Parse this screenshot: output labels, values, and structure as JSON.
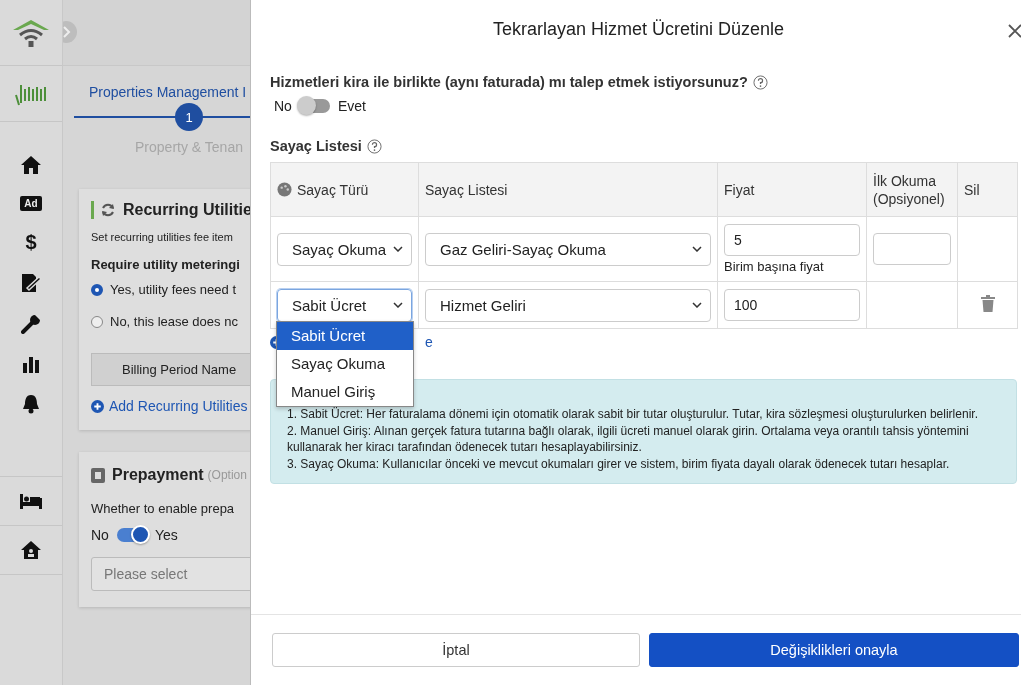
{
  "sidebar": {
    "items": [
      {
        "kind": "home"
      },
      {
        "kind": "badge",
        "label": "Ad"
      },
      {
        "kind": "glyph",
        "label": "$"
      },
      {
        "kind": "sign"
      },
      {
        "kind": "wrench"
      },
      {
        "kind": "chart"
      },
      {
        "kind": "bell"
      }
    ],
    "bottom_items": [
      {
        "kind": "bed"
      },
      {
        "kind": "house"
      }
    ]
  },
  "background_page": {
    "breadcrumb": "Properties Management I",
    "steps": [
      {
        "number": "1",
        "label": "Property & Tenan",
        "selected": true
      }
    ],
    "utilities_card": {
      "title": "Recurring Utilitie",
      "description": "Set recurring utilities fee item",
      "question": "Require utility meteringi",
      "options": [
        {
          "label": "Yes, utility fees need t",
          "selected": true
        },
        {
          "label": "No, this lease does nc",
          "selected": false
        }
      ],
      "column_header": "Billing Period Name",
      "add_link": "Add Recurring Utilities"
    },
    "prepayment_card": {
      "title": "Prepayment",
      "hint": "(Option",
      "question": "Whether to enable prepa",
      "toggle": {
        "off_label": "No",
        "on_label": "Yes",
        "on": true
      },
      "select": {
        "placeholder": "Please select"
      }
    }
  },
  "modal": {
    "title": "Tekrarlayan Hizmet Ücretini Düzenle",
    "question": "Hizmetleri kira ile birlikte (aynı faturada) mı talep etmek istiyorsunuz?",
    "toggle": {
      "off_label": "No",
      "on_label": "Evet",
      "on": false
    },
    "list_title": "Sayaç Listesi",
    "table": {
      "columns": [
        "Sayaç Türü",
        "Sayaç Listesi",
        "Fiyat",
        "İlk Okuma (Opsiyonel)",
        "Sil"
      ],
      "rows": [
        {
          "type": "Sayaç Okuma",
          "list": "Gaz Geliri-Sayaç Okuma",
          "price": "5",
          "price_hint": "Birim başına fiyat",
          "has_reading_field": true,
          "deletable": false,
          "focused": false
        },
        {
          "type": "Sabit Ücret",
          "list": "Hizmet Geliri",
          "price": "100",
          "has_reading_field": false,
          "deletable": true,
          "focused": true
        }
      ]
    },
    "dropdown": {
      "options": [
        {
          "label": "Sabit Ücret",
          "selected": true
        },
        {
          "label": "Sayaç Okuma",
          "selected": false
        },
        {
          "label": "Manuel Giriş",
          "selected": false
        }
      ]
    },
    "add_link_tail": "e",
    "info": [
      "1. Sabit Ücret: Her faturalama dönemi için otomatik olarak sabit bir tutar oluşturulur. Tutar, kira sözleşmesi oluşturulurken belirlenir.",
      "2. Manuel Giriş: Alınan gerçek fatura tutarına bağlı olarak, ilgili ücreti manuel olarak girin. Ortalama veya orantılı tahsis yöntemini kullanarak her kiracı tarafından ödenecek tutarı hesaplayabilirsiniz.",
      "3. Sayaç Okuma: Kullanıcılar önceki ve mevcut okumaları girer ve sistem, birim fiyata dayalı olarak ödenecek tutarı hesaplar."
    ],
    "buttons": {
      "cancel": "İptal",
      "confirm": "Değişiklikleri onayla"
    }
  }
}
